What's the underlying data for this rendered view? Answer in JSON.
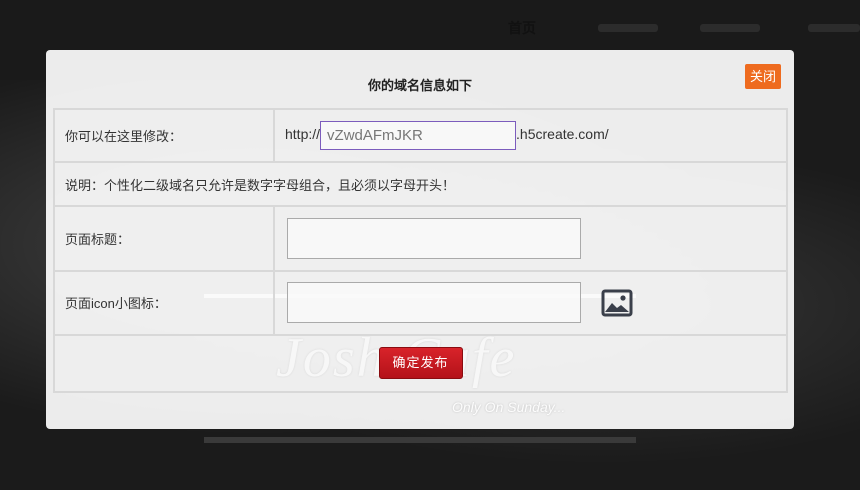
{
  "nav": {
    "home": "首页"
  },
  "modal": {
    "title": "你的域名信息如下",
    "close_label": "关闭",
    "domain_label": "你可以在这里修改：",
    "url_prefix": "http://",
    "domain_value": "vZwdAFmJKR",
    "url_suffix": ".h5create.com/",
    "note": "说明：个性化二级域名只允许是数字字母组合，且必须以字母开头！",
    "page_title_label": "页面标题：",
    "page_title_value": "",
    "page_icon_label": "页面icon小图标：",
    "page_icon_value": "",
    "submit_label": "确定发布"
  },
  "background": {
    "watermark_title": "Josh Cafe",
    "watermark_subtitle": "Only On Sunday..."
  },
  "colors": {
    "close_button": "#ee6b1f",
    "submit_button": "#c81a21",
    "input_focus_border": "#7c5cbd"
  },
  "icons": {
    "upload": "image-icon"
  }
}
